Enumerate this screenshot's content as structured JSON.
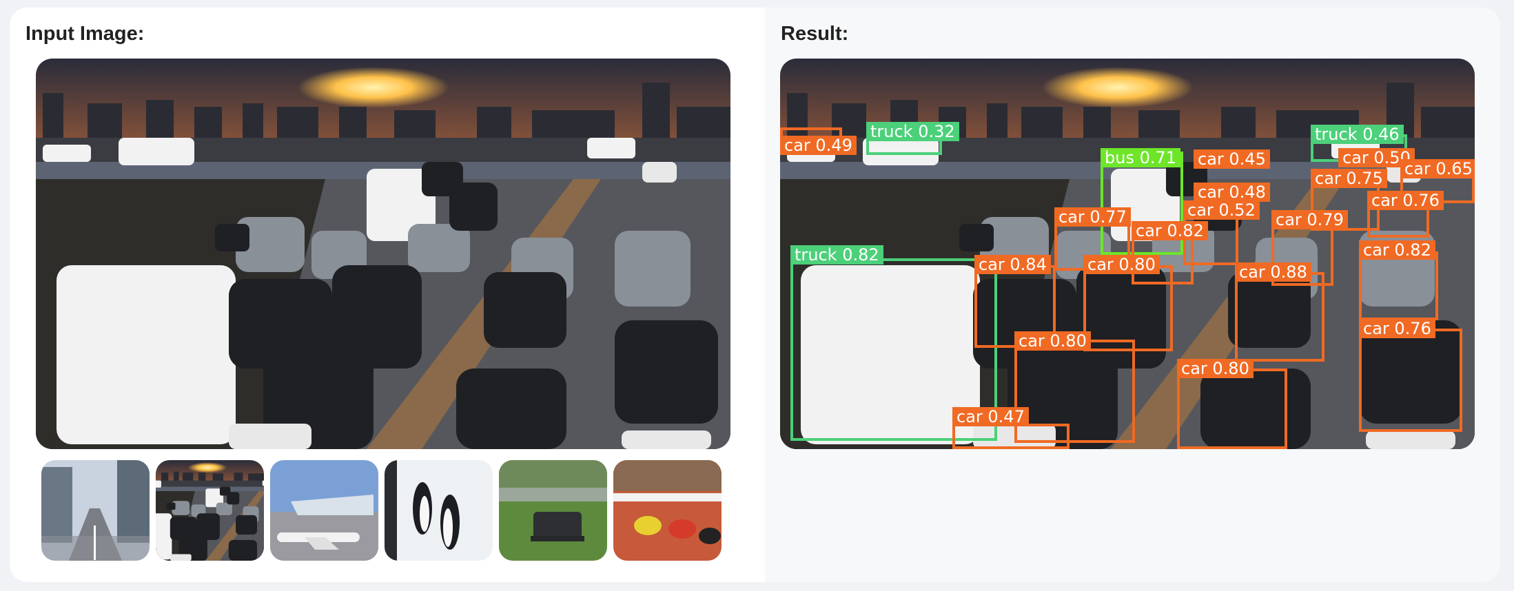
{
  "input_panel": {
    "title": "Input Image:"
  },
  "result_panel": {
    "title": "Result:"
  },
  "thumbnails": [
    {
      "name": "city-street"
    },
    {
      "name": "highway-traffic"
    },
    {
      "name": "airport-plane"
    },
    {
      "name": "penguins"
    },
    {
      "name": "park-bench"
    },
    {
      "name": "sprinters"
    }
  ],
  "detections": [
    {
      "label": "car 0.49",
      "color": "#f06a24"
    },
    {
      "label": "truck 0.32",
      "color": "#4cd07a"
    },
    {
      "label": "truck 0.46",
      "color": "#4cd07a"
    },
    {
      "label": "bus 0.71",
      "color": "#6de62a"
    },
    {
      "label": "car 0.45",
      "color": "#f06a24"
    },
    {
      "label": "car 0.50",
      "color": "#f06a24"
    },
    {
      "label": "car 0.65",
      "color": "#f06a24"
    },
    {
      "label": "car 0.75",
      "color": "#f06a24"
    },
    {
      "label": "car 0.48",
      "color": "#f06a24"
    },
    {
      "label": "car 0.52",
      "color": "#f06a24"
    },
    {
      "label": "car 0.76",
      "color": "#f06a24"
    },
    {
      "label": "car 0.77",
      "color": "#f06a24"
    },
    {
      "label": "car 0.82",
      "color": "#f06a24"
    },
    {
      "label": "car 0.79",
      "color": "#f06a24"
    },
    {
      "label": "truck 0.82",
      "color": "#4cd07a"
    },
    {
      "label": "car 0.84",
      "color": "#f06a24"
    },
    {
      "label": "car 0.80",
      "color": "#f06a24"
    },
    {
      "label": "car 0.88",
      "color": "#f06a24"
    },
    {
      "label": "car 0.82",
      "color": "#f06a24"
    },
    {
      "label": "car 0.76",
      "color": "#f06a24"
    },
    {
      "label": "car 0.80",
      "color": "#f06a24"
    },
    {
      "label": "car 0.80",
      "color": "#f06a24"
    },
    {
      "label": "car 0.47",
      "color": "#f06a24"
    }
  ]
}
